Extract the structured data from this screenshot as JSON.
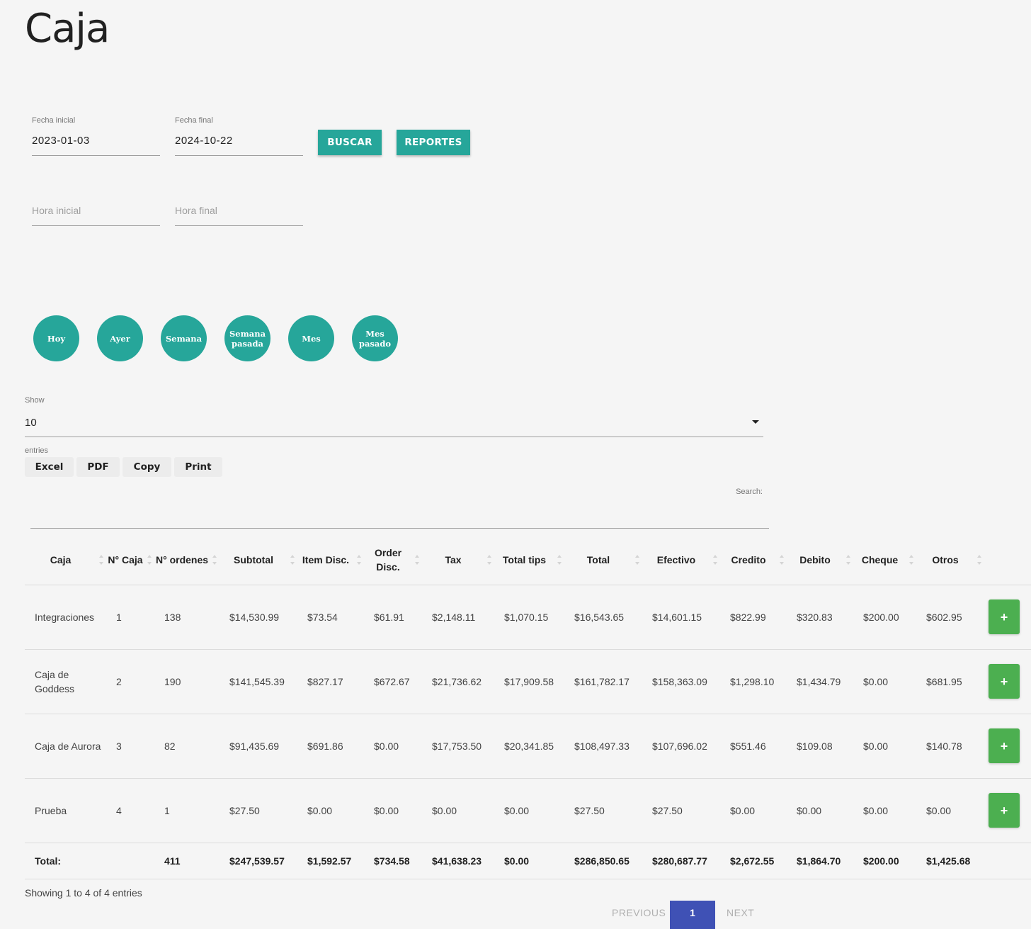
{
  "page": {
    "title": "Caja"
  },
  "filters": {
    "start_date": {
      "label": "Fecha inicial",
      "value": "2023-01-03"
    },
    "end_date": {
      "label": "Fecha final",
      "value": "2024-10-22"
    },
    "start_time": {
      "placeholder": "Hora inicial"
    },
    "end_time": {
      "placeholder": "Hora final"
    },
    "search_button": "BUSCAR",
    "reports_button": "REPORTES"
  },
  "quick_ranges": [
    "Hoy",
    "Ayer",
    "Semana",
    "Semana pasada",
    "Mes",
    "Mes pasado"
  ],
  "table_controls": {
    "show_label": "Show",
    "show_value": "10",
    "entries_label": "entries",
    "export_buttons": [
      "Excel",
      "PDF",
      "Copy",
      "Print"
    ],
    "search_label": "Search:"
  },
  "table": {
    "columns": [
      "Caja",
      "N° Caja",
      "N° ordenes",
      "Subtotal",
      "Item Disc.",
      "Order Disc.",
      "Tax",
      "Total tips",
      "Total",
      "Efectivo",
      "Credito",
      "Debito",
      "Cheque",
      "Otros",
      ""
    ],
    "rows": [
      [
        "Integraciones",
        "1",
        "138",
        "$14,530.99",
        "$73.54",
        "$61.91",
        "$2,148.11",
        "$1,070.15",
        "$16,543.65",
        "$14,601.15",
        "$822.99",
        "$320.83",
        "$200.00",
        "$602.95"
      ],
      [
        "Caja de Goddess",
        "2",
        "190",
        "$141,545.39",
        "$827.17",
        "$672.67",
        "$21,736.62",
        "$17,909.58",
        "$161,782.17",
        "$158,363.09",
        "$1,298.10",
        "$1,434.79",
        "$0.00",
        "$681.95"
      ],
      [
        "Caja de Aurora",
        "3",
        "82",
        "$91,435.69",
        "$691.86",
        "$0.00",
        "$17,753.50",
        "$20,341.85",
        "$108,497.33",
        "$107,696.02",
        "$551.46",
        "$109.08",
        "$0.00",
        "$140.78"
      ],
      [
        "Prueba",
        "4",
        "1",
        "$27.50",
        "$0.00",
        "$0.00",
        "$0.00",
        "$0.00",
        "$27.50",
        "$27.50",
        "$0.00",
        "$0.00",
        "$0.00",
        "$0.00"
      ]
    ],
    "row_action_label": "+",
    "totals": [
      "Total:",
      "",
      "411",
      "$247,539.57",
      "$1,592.57",
      "$734.58",
      "$41,638.23",
      "$0.00",
      "$286,850.65",
      "$280,687.77",
      "$2,672.55",
      "$1,864.70",
      "$200.00",
      "$1,425.68"
    ]
  },
  "pagination": {
    "info": "Showing 1 to 4 of 4 entries",
    "previous": "PREVIOUS",
    "current": "1",
    "next": "NEXT"
  },
  "colors": {
    "teal": "#26a69a",
    "green": "#4caf50",
    "indigo": "#3f51b5"
  }
}
